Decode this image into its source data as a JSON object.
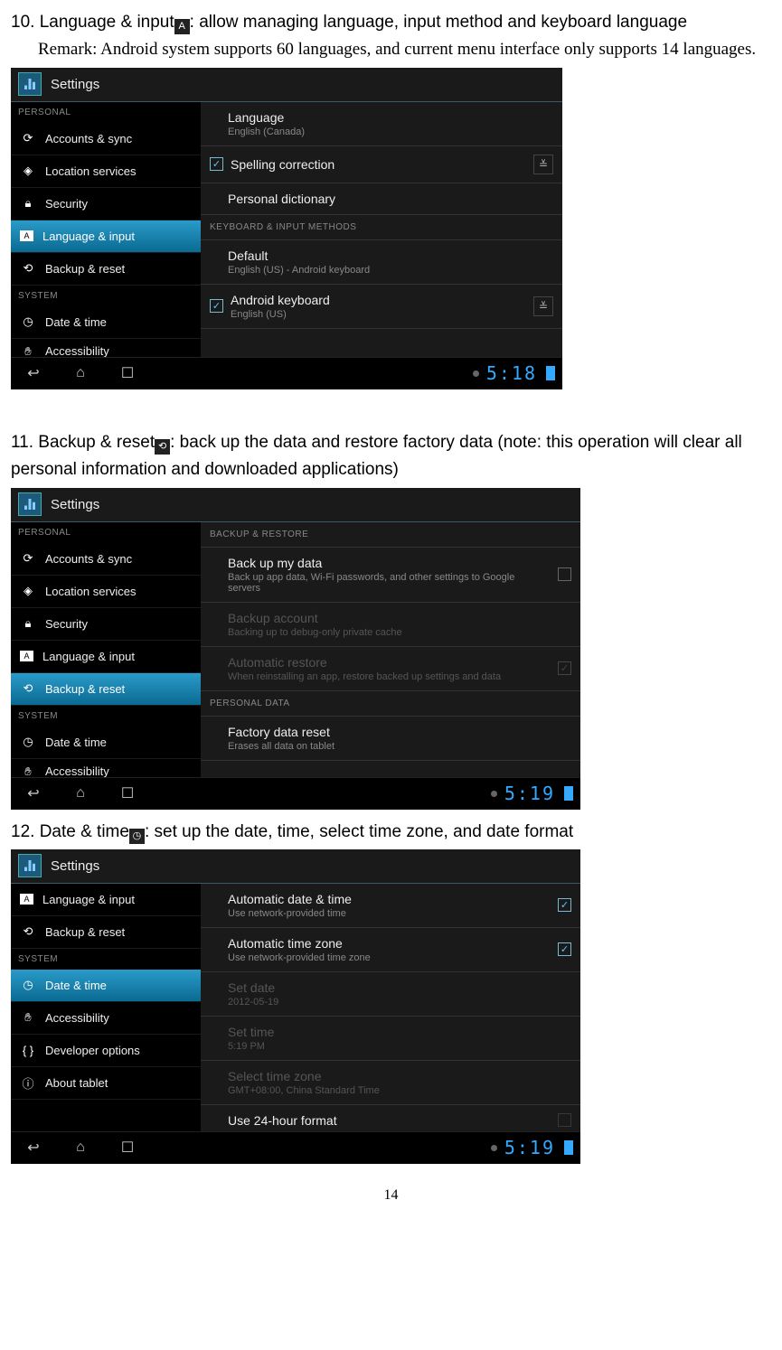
{
  "page_number": "14",
  "section10": {
    "title_a": "10. Language & input",
    "title_b": ": allow managing language, input method and keyboard language",
    "remark": "Remark: Android system supports 60 languages, and current menu interface only supports 14 languages."
  },
  "section11": {
    "title_a": "11. Backup & reset",
    "title_b": ": back up the data and restore factory data (note: this operation will clear all personal information and downloaded applications)"
  },
  "section12": {
    "title_a": "12. Date & time",
    "title_b": ": set up the date, time, select time zone, and date format"
  },
  "ss_common": {
    "settings": "Settings",
    "personal": "PERSONAL",
    "system": "SYSTEM"
  },
  "side": {
    "accounts": "Accounts & sync",
    "location": "Location services",
    "security": "Security",
    "language": "Language & input",
    "backup": "Backup & reset",
    "datetime": "Date & time",
    "accessibility": "Accessibility",
    "developer": "Developer options",
    "about": "About tablet"
  },
  "ss1": {
    "lang_t": "Language",
    "lang_s": "English (Canada)",
    "spell": "Spelling correction",
    "dict": "Personal dictionary",
    "kb_header": "KEYBOARD & INPUT METHODS",
    "default_t": "Default",
    "default_s": "English (US) - Android keyboard",
    "ak_t": "Android keyboard",
    "ak_s": "English (US)",
    "time": "5:18"
  },
  "ss2": {
    "br_header": "BACKUP & RESTORE",
    "bd_t": "Back up my data",
    "bd_s": "Back up app data, Wi-Fi passwords, and other settings to Google servers",
    "ba_t": "Backup account",
    "ba_s": "Backing up to debug-only private cache",
    "ar_t": "Automatic restore",
    "ar_s": "When reinstalling an app, restore backed up settings and data",
    "pd_header": "PERSONAL DATA",
    "fr_t": "Factory data reset",
    "fr_s": "Erases all data on tablet",
    "time": "5:19"
  },
  "ss3": {
    "adt_t": "Automatic date & time",
    "adt_s": "Use network-provided time",
    "atz_t": "Automatic time zone",
    "atz_s": "Use network-provided time zone",
    "sd_t": "Set date",
    "sd_s": "2012-05-19",
    "st_t": "Set time",
    "st_s": "5:19 PM",
    "stz_t": "Select time zone",
    "stz_s": "GMT+08:00, China Standard Time",
    "u24_t": "Use 24-hour format",
    "time": "5:19"
  }
}
